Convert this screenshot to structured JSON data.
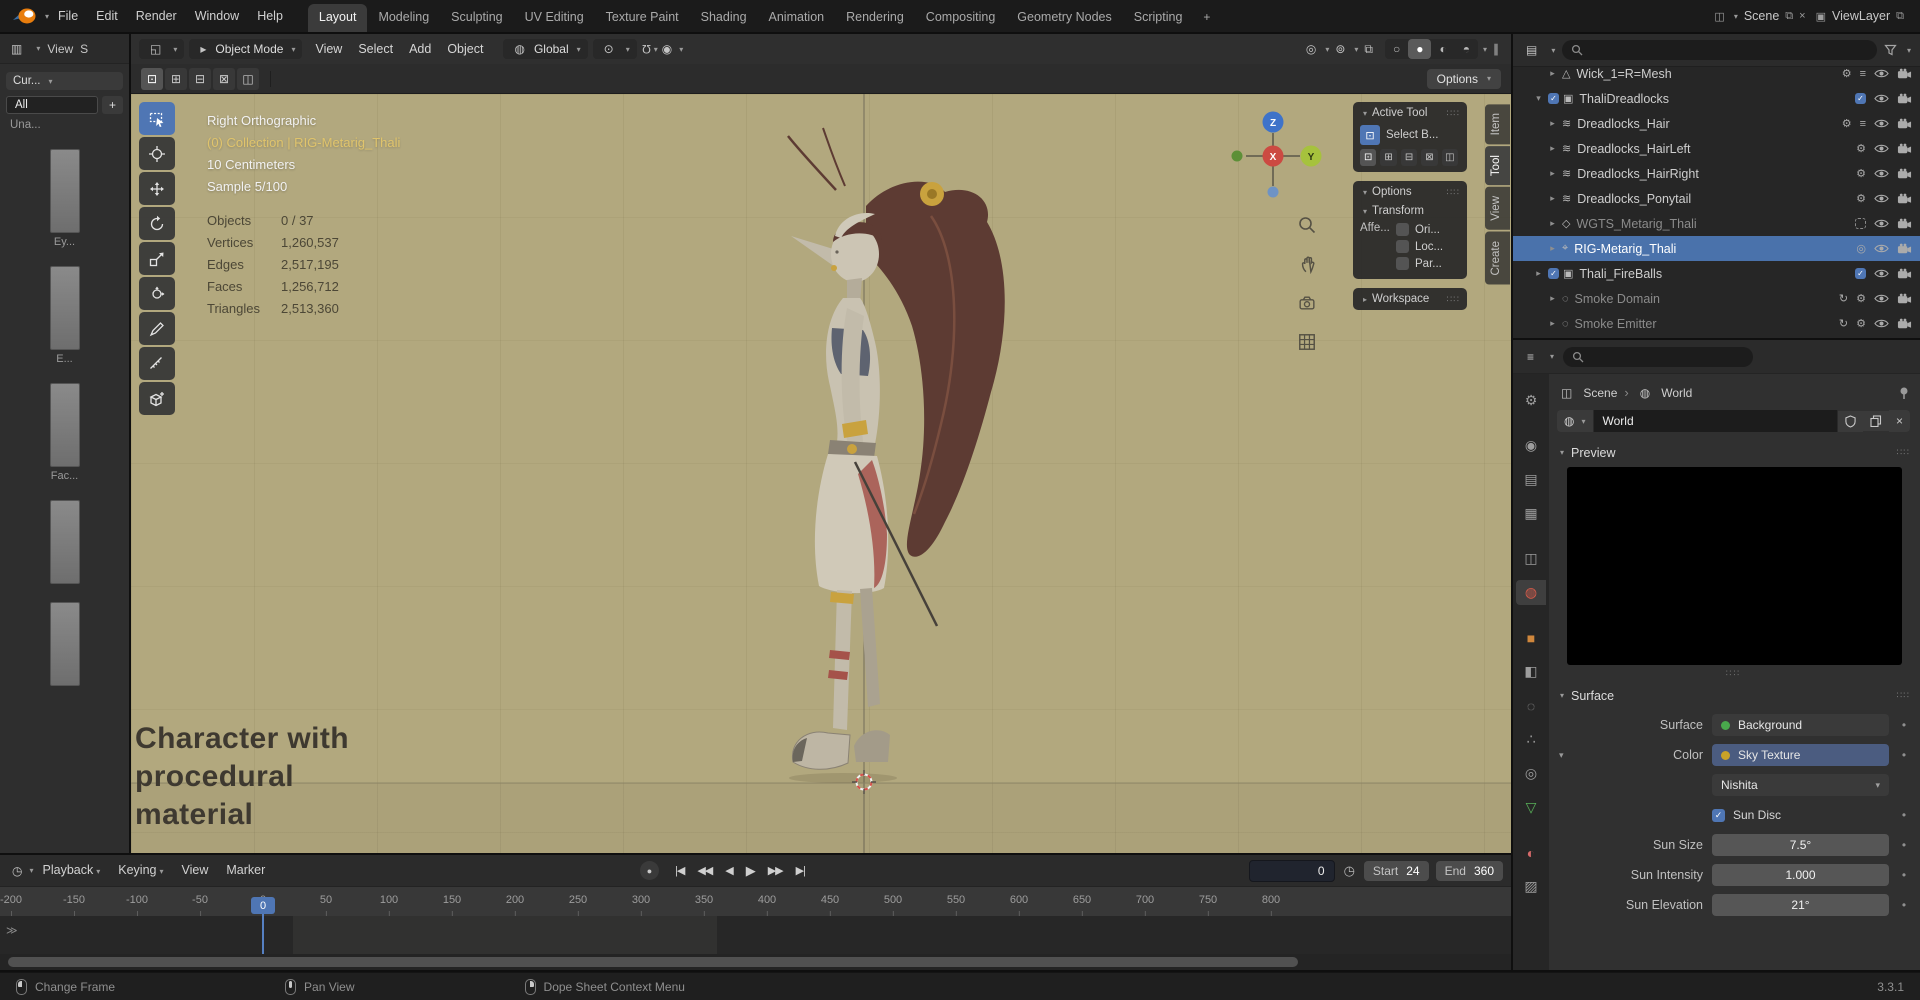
{
  "colors": {
    "accent_blue": "#4f76b4",
    "viewport_background": "#b2a87e",
    "selected_row": "#4a72ab",
    "active_object_text": "#e0c46c"
  },
  "topbar": {
    "menus": [
      "File",
      "Edit",
      "Render",
      "Window",
      "Help"
    ],
    "workspaces": [
      "Layout",
      "Modeling",
      "Sculpting",
      "UV Editing",
      "Texture Paint",
      "Shading",
      "Animation",
      "Rendering",
      "Compositing",
      "Geometry Nodes",
      "Scripting"
    ],
    "active_workspace": "Layout",
    "add_tab": "+",
    "scene": {
      "label": "Scene"
    },
    "view_layer": {
      "label": "ViewLayer"
    }
  },
  "left_strip": {
    "menus": [
      "View",
      "S"
    ],
    "brush_dropdown": "Cur...",
    "filter_all": "All",
    "add": "+",
    "item2": "Una...",
    "thumb_labels": [
      "Ey...",
      "E...",
      "Fac..."
    ]
  },
  "viewport": {
    "header": {
      "mode": "Object Mode",
      "menus": [
        "View",
        "Select",
        "Add",
        "Object"
      ],
      "orientation": "Global"
    },
    "tool_settings": {
      "modes": [
        "new",
        "extend",
        "subtract",
        "invert",
        "intersect"
      ],
      "options_label": "Options"
    },
    "toolbar": [
      "select-box",
      "cursor",
      "move",
      "rotate",
      "scale",
      "transform",
      "annotate",
      "measure",
      "add-cube"
    ],
    "active_tool": "select-box",
    "info": {
      "view": "Right Orthographic",
      "context": "(0) Collection | RIG-Metarig_Thali",
      "unit": "10 Centimeters",
      "sample": "Sample 5/100"
    },
    "stats": [
      [
        "Objects",
        "0 / 37"
      ],
      [
        "Vertices",
        "1,260,537"
      ],
      [
        "Edges",
        "2,517,195"
      ],
      [
        "Faces",
        "1,256,712"
      ],
      [
        "Triangles",
        "2,513,360"
      ]
    ],
    "annotation": [
      "Character with",
      "procedural",
      "material"
    ],
    "gizmo": {
      "up": "Z",
      "center": "X",
      "right": "Y"
    },
    "n_tabs": [
      "Item",
      "Tool",
      "View",
      "Create"
    ],
    "active_n_tab": "Tool",
    "panels": {
      "active_tool": {
        "title": "Active Tool",
        "tool_label": "Select B..."
      },
      "options": {
        "title": "Options",
        "transform": "Transform",
        "affect_label": "Affe...",
        "checks": [
          "Ori...",
          "Loc...",
          "Par..."
        ]
      },
      "workspace": {
        "title": "Workspace"
      }
    }
  },
  "outliner": {
    "rows": [
      {
        "label": "Wick_1=R=Mesh",
        "indent": 2,
        "icon": "mesh",
        "caret": "right",
        "extras": [
          "mod",
          "data"
        ],
        "partial": true
      },
      {
        "label": "ThaliDreadlocks",
        "indent": 1,
        "icon": "collection",
        "caret": "down",
        "checkbox": true,
        "right_check": "checked"
      },
      {
        "label": "Dreadlocks_Hair",
        "indent": 2,
        "icon": "hair",
        "caret": "right",
        "extras": [
          "wrench",
          "data"
        ]
      },
      {
        "label": "Dreadlocks_HairLeft",
        "indent": 2,
        "icon": "hair",
        "caret": "right",
        "extras": [
          "wrench"
        ]
      },
      {
        "label": "Dreadlocks_HairRight",
        "indent": 2,
        "icon": "hair",
        "caret": "right",
        "extras": [
          "wrench"
        ]
      },
      {
        "label": "Dreadlocks_Ponytail",
        "indent": 2,
        "icon": "hair",
        "caret": "right",
        "extras": [
          "wrench"
        ]
      },
      {
        "label": "WGTS_Metarig_Thali",
        "indent": 2,
        "icon": "empty",
        "caret": "right",
        "grayed": true,
        "right_check": "empty"
      },
      {
        "label": "RIG-Metarig_Thali",
        "indent": 2,
        "icon": "armature",
        "caret": "right",
        "selected": true,
        "extras": [
          "person"
        ]
      },
      {
        "label": "Thali_FireBalls",
        "indent": 1,
        "icon": "collection",
        "caret": "right",
        "checkbox": true,
        "right_check": "checked"
      },
      {
        "label": "Smoke Domain",
        "indent": 2,
        "icon": "smoke",
        "caret": "right",
        "grayed": true,
        "extras": [
          "link",
          "mod"
        ]
      },
      {
        "label": "Smoke Emitter",
        "indent": 2,
        "icon": "smoke",
        "caret": "right",
        "grayed": true,
        "extras": [
          "link",
          "mod"
        ]
      }
    ]
  },
  "properties": {
    "breadcrumb": {
      "scene": "Scene",
      "world": "World"
    },
    "datablock": "World",
    "preview_title": "Preview",
    "surface_title": "Surface",
    "rows": [
      {
        "type": "socket",
        "label": "Surface",
        "value": "Background",
        "dot": "#49a84c"
      },
      {
        "type": "socket",
        "label": "Color",
        "value": "Sky Texture",
        "dot": "#c9a227",
        "highlight": true,
        "caret": true
      },
      {
        "type": "dropdown",
        "label": "",
        "value": "Nishita"
      },
      {
        "type": "checkbox",
        "label": "",
        "value": "Sun Disc",
        "checked": true
      },
      {
        "type": "number",
        "label": "Sun Size",
        "value": "7.5°"
      },
      {
        "type": "number",
        "label": "Sun Intensity",
        "value": "1.000"
      },
      {
        "type": "number",
        "label": "Sun Elevation",
        "value": "21°"
      }
    ],
    "tabs": [
      "tool",
      "render",
      "output",
      "view-layer",
      "scene",
      "world",
      "object",
      "modifiers",
      "physics",
      "particles",
      "constraints",
      "data",
      "material",
      "texture"
    ],
    "active_tab": "world"
  },
  "timeline": {
    "menus": [
      "Playback",
      "Keying",
      "View",
      "Marker"
    ],
    "transport": [
      "jump-start",
      "prev-keyframe",
      "play-reverse",
      "play",
      "next-keyframe",
      "jump-end"
    ],
    "current_frame": "0",
    "start": {
      "label": "Start",
      "value": "24"
    },
    "end": {
      "label": "End",
      "value": "360"
    },
    "ticks": [
      -200,
      -150,
      -100,
      -50,
      0,
      50,
      100,
      150,
      200,
      250,
      300,
      350,
      400,
      450,
      500,
      550,
      600,
      650,
      700,
      750,
      800
    ],
    "range": {
      "start": 24,
      "end": 360
    },
    "playhead": 0
  },
  "status_bar": {
    "hints": [
      {
        "mouse": "left",
        "label": "Change Frame"
      },
      {
        "mouse": "middle",
        "label": "Pan View"
      },
      {
        "mouse": "right",
        "label": "Dope Sheet Context Menu"
      }
    ],
    "version": "3.3.1"
  }
}
